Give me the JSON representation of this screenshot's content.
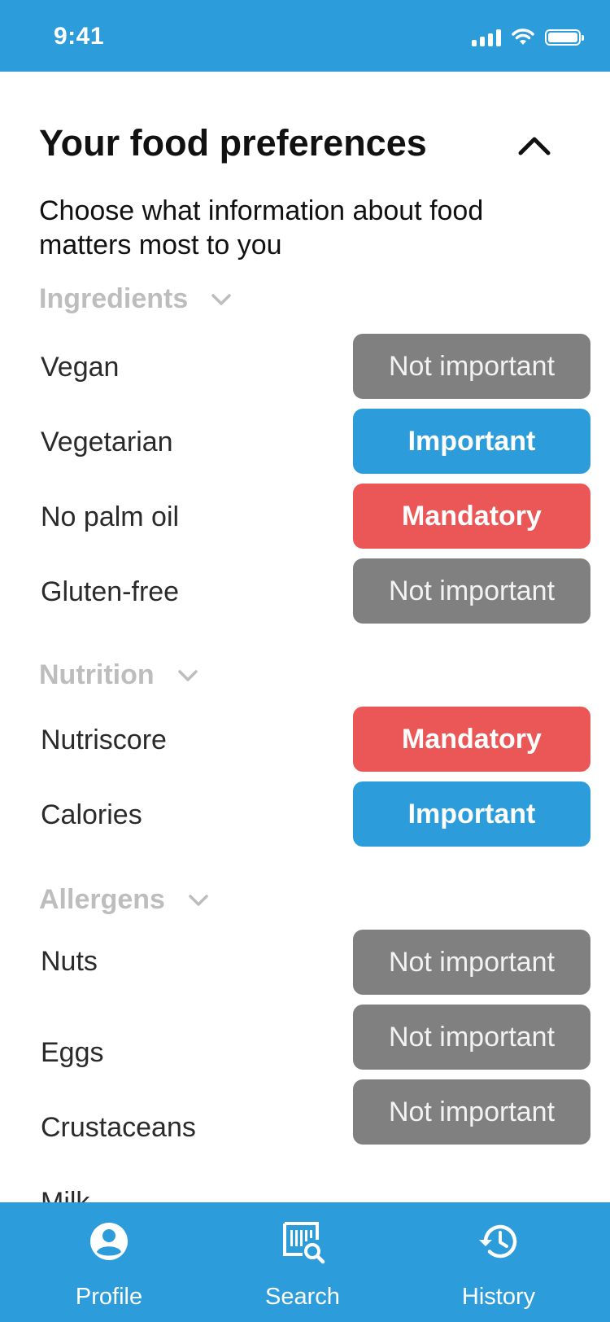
{
  "status_bar": {
    "time": "9:41"
  },
  "header": {
    "title": "Your food preferences",
    "subtitle": "Choose what information about food matters most to you"
  },
  "colors": {
    "primary": "#2d9cdb",
    "not_important": "#808080",
    "important": "#2d9cdb",
    "mandatory": "#eb5757",
    "section_label": "#bdbdbd"
  },
  "sections": [
    {
      "label": "Ingredients",
      "items": [
        {
          "label": "Vegan",
          "value": "Not important"
        },
        {
          "label": "Vegetarian",
          "value": "Important"
        },
        {
          "label": "No palm oil",
          "value": "Mandatory"
        },
        {
          "label": "Gluten-free",
          "value": "Not important"
        }
      ]
    },
    {
      "label": "Nutrition",
      "items": [
        {
          "label": "Nutriscore",
          "value": "Mandatory"
        },
        {
          "label": "Calories",
          "value": "Important"
        }
      ]
    },
    {
      "label": "Allergens",
      "items": [
        {
          "label": "Nuts",
          "value": "Not important"
        },
        {
          "label": "Eggs",
          "value": "Not important"
        },
        {
          "label": "Crustaceans",
          "value": "Not important"
        },
        {
          "label": "Milk"
        }
      ]
    }
  ],
  "tab_bar": {
    "tabs": [
      {
        "label": "Profile",
        "icon": "profile-icon"
      },
      {
        "label": "Search",
        "icon": "barcode-search-icon"
      },
      {
        "label": "History",
        "icon": "history-icon"
      }
    ]
  }
}
